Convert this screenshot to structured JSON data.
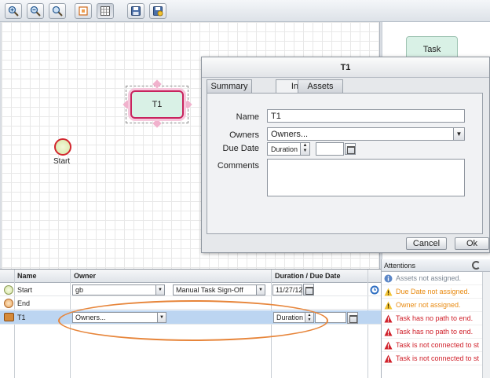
{
  "toolbar": {
    "buttons": [
      "zoom-in-icon",
      "zoom-out-icon",
      "zoom-reset-icon",
      "fit-to-screen-icon",
      "grid-toggle-icon",
      "save-icon",
      "save-as-icon"
    ]
  },
  "canvas": {
    "start_label": "Start",
    "task_label": "T1"
  },
  "palette": {
    "task_label": "Task"
  },
  "dialog": {
    "title": "T1",
    "tabs": [
      "Summary",
      "Info",
      "Assets"
    ],
    "active_tab": "Info",
    "name_label": "Name",
    "name_value": "T1",
    "owners_label": "Owners",
    "owners_value": "Owners...",
    "due_label": "Due Date",
    "due_type": "Duration",
    "comments_label": "Comments",
    "cancel_label": "Cancel",
    "ok_label": "Ok"
  },
  "grid": {
    "columns": [
      "Name",
      "Owner",
      "Duration / Due Date"
    ],
    "rows": [
      {
        "name": "Start",
        "owner": "gb",
        "signoff": "Manual Task Sign-Off",
        "date": "11/27/12"
      },
      {
        "name": "End",
        "owner": "",
        "signoff": "",
        "date": ""
      },
      {
        "name": "T1",
        "owner": "Owners...",
        "signoff": "",
        "date": "Duration"
      }
    ]
  },
  "attentions": {
    "title": "Attentions",
    "items": [
      {
        "text": "Assets not assigned.",
        "level": "info",
        "color": "#7c8794"
      },
      {
        "text": "Due Date not assigned.",
        "level": "warning",
        "color": "#e98b12"
      },
      {
        "text": "Owner not assigned.",
        "level": "warning",
        "color": "#e98b12"
      },
      {
        "text": "Task has no path to end.",
        "level": "error",
        "color": "#d0202a"
      },
      {
        "text": "Task has no path to end.",
        "level": "error",
        "color": "#d0202a"
      },
      {
        "text": "Task is not connected to st",
        "level": "error",
        "color": "#d0202a"
      },
      {
        "text": "Task is not connected to st",
        "level": "error",
        "color": "#d0202a"
      }
    ]
  }
}
